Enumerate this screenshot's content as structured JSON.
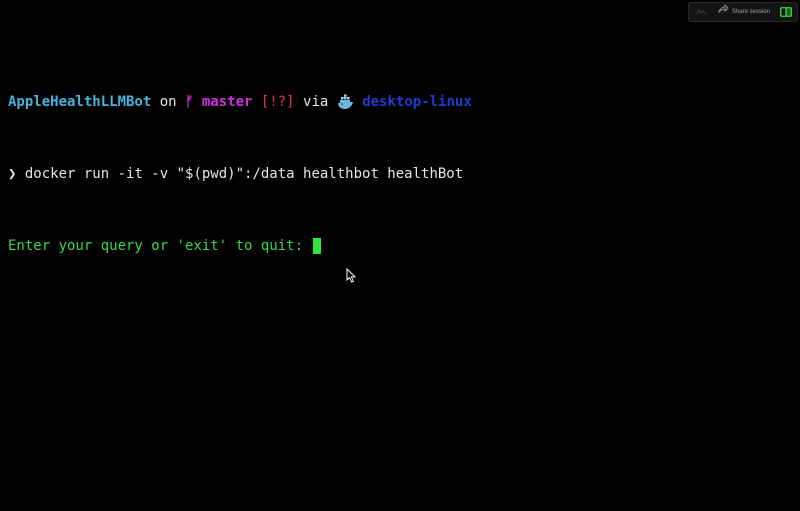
{
  "toolbar": {
    "share_label": "Share session"
  },
  "terminal": {
    "prompt_line": {
      "repo": "AppleHealthLLMBot",
      "on": " on ",
      "branch_glyph": "ᚠ",
      "branch": "master",
      "status": "[!?]",
      "via": " via ",
      "docker_context": "desktop-linux"
    },
    "command_line": {
      "prompt_symbol": "❯",
      "command": "docker run -it -v \"$(pwd)\":/data healthbot healthBot"
    },
    "output_line": {
      "text": "Enter your query or 'exit' to quit: "
    }
  },
  "colors": {
    "background": "#000000",
    "repo": "#46b4e0",
    "branch": "#d22ee4",
    "status": "#e3344f",
    "docker": "#1f3cd4",
    "output": "#34d94a",
    "cursor": "#2ee83c"
  },
  "icons": {
    "branch": "git-branch-icon",
    "docker": "docker-whale-icon",
    "share": "share-arrow-icon",
    "split": "split-pane-icon",
    "mouse": "mouse-pointer-icon"
  }
}
